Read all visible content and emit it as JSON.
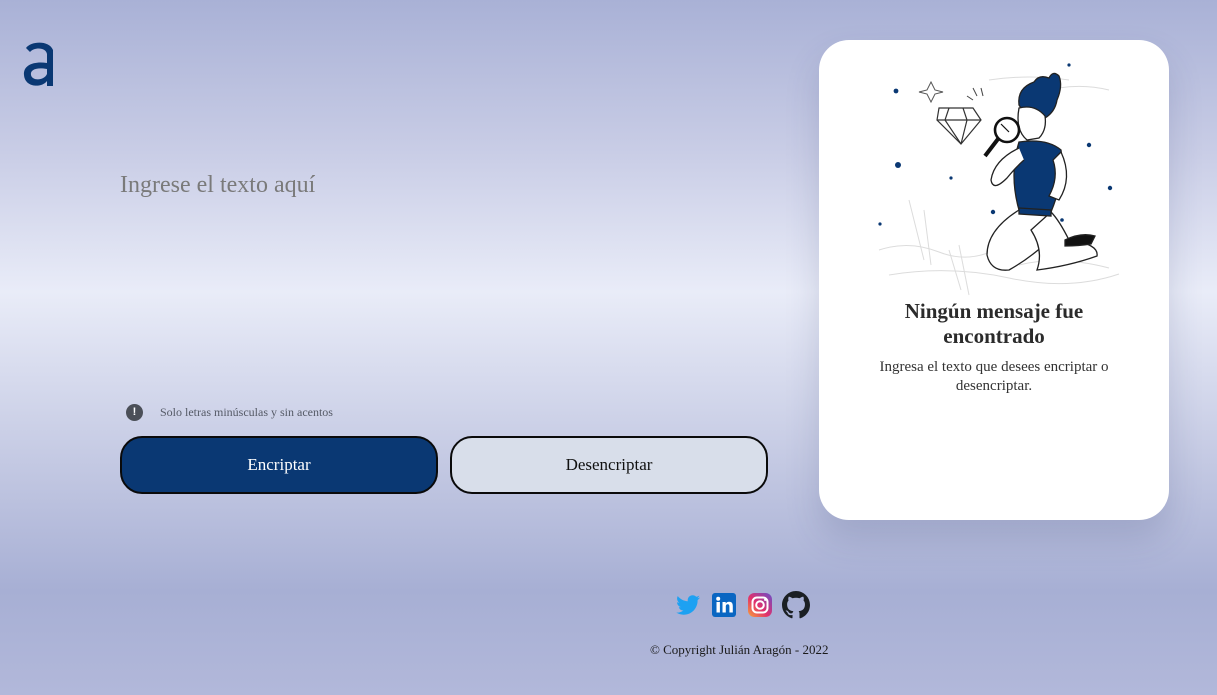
{
  "logo": {
    "icon": "alura-logo-icon",
    "color": "#0a3873"
  },
  "input": {
    "placeholder": "Ingrese el texto aquí",
    "value": ""
  },
  "hint": {
    "icon": "exclamation-circle-icon",
    "text": "Solo letras minúsculas y sin acentos"
  },
  "buttons": {
    "encrypt_label": "Encriptar",
    "decrypt_label": "Desencriptar"
  },
  "output": {
    "illustration": "person-with-magnifying-glass-and-diamond",
    "title": "Ningún mensaje fue encontrado",
    "text": "Ingresa el texto que desees encriptar o desencriptar."
  },
  "footer": {
    "socials": [
      {
        "name": "twitter",
        "icon": "twitter-icon"
      },
      {
        "name": "linkedin",
        "icon": "linkedin-icon"
      },
      {
        "name": "instagram",
        "icon": "instagram-icon"
      },
      {
        "name": "github",
        "icon": "github-icon"
      }
    ],
    "copyright": "© Copyright Julián Aragón - 2022"
  },
  "colors": {
    "primary": "#0a3873",
    "secondary_button": "#d8deea",
    "card_background": "#ffffff",
    "twitter": "#1da1f2",
    "linkedin": "#0a66c2"
  }
}
